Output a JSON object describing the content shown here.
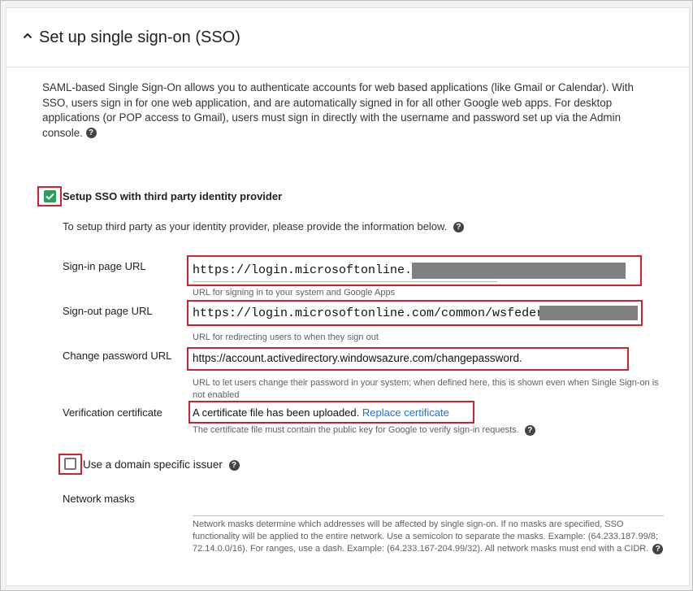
{
  "section": {
    "title": "Set up single sign-on (SSO)",
    "description": "SAML-based Single Sign-On allows you to authenticate accounts for web based applications (like Gmail or Calendar). With SSO, users sign in for one web application, and are automatically signed in for all other Google web apps. For desktop applications (or POP access to Gmail), users must sign in directly with the username and password set up via the Admin console."
  },
  "third_party": {
    "checkbox_label": "Setup SSO with third party identity provider",
    "checked": true,
    "intro": "To setup third party as your identity provider, please provide the information below."
  },
  "fields": {
    "signin": {
      "label": "Sign-in page URL",
      "value": "https://login.microsoftonline.com/",
      "hint": "URL for signing in to your system and Google Apps"
    },
    "signout": {
      "label": "Sign-out page URL",
      "value": "https://login.microsoftonline.com/common/wsfederation",
      "hint": "URL for redirecting users to when they sign out"
    },
    "change_password": {
      "label": "Change password URL",
      "value": "https://account.activedirectory.windowsazure.com/changepassword.",
      "hint": "URL to let users change their password in your system; when defined here, this is shown even when Single Sign-on is not enabled"
    },
    "certificate": {
      "label": "Verification certificate",
      "status": "A certificate file has been uploaded.",
      "replace_link": "Replace certificate",
      "hint": "The certificate file must contain the public key for Google to verify sign-in requests."
    }
  },
  "domain_issuer": {
    "label": "Use a domain specific issuer",
    "checked": false
  },
  "network_masks": {
    "label": "Network masks",
    "value": "",
    "hint": "Network masks determine which addresses will be affected by single sign-on. If no masks are specified, SSO functionality will be applied to the entire network. Use a semicolon to separate the masks. Example: (64.233.187.99/8; 72.14.0.0/16). For ranges, use a dash. Example: (64.233.167-204.99/32). All network masks must end with a CIDR."
  },
  "colors": {
    "highlight": "#d3202f",
    "checkbox_checked": "#2e9c5b",
    "link": "#1a73e8"
  }
}
